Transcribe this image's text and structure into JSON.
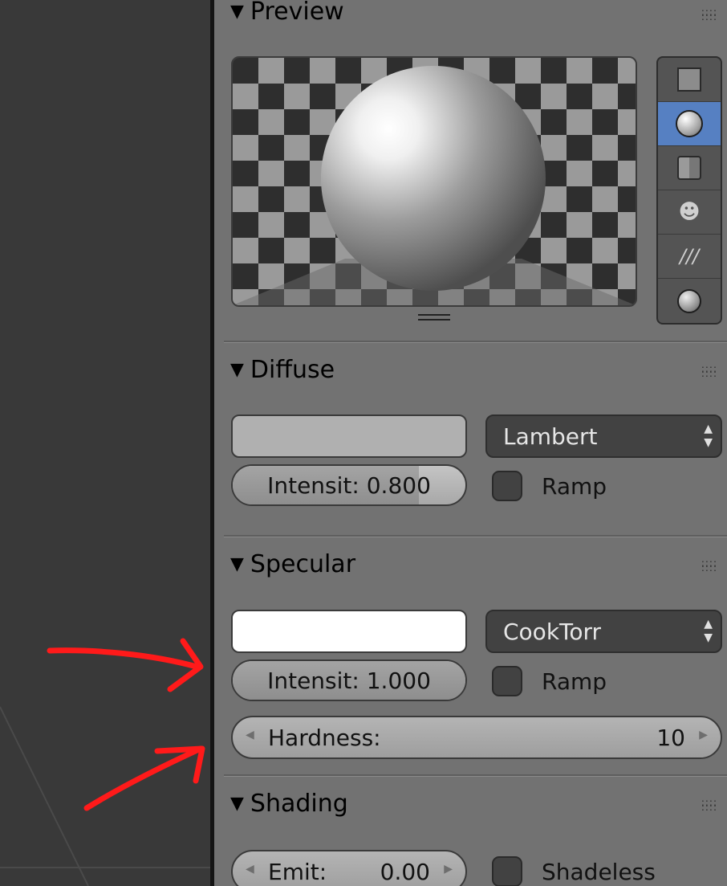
{
  "panels": {
    "preview": {
      "title": "Preview",
      "types": [
        "flat-plane-icon",
        "sphere-icon",
        "cube-icon",
        "monkey-icon",
        "hair-icon",
        "sphere-a-icon"
      ],
      "active_type": 1
    },
    "diffuse": {
      "title": "Diffuse",
      "color": "#b0b0b0",
      "shader": "Lambert",
      "intensity_label": "Intensit:",
      "intensity_value": "0.800",
      "intensity_fraction": 0.8,
      "ramp_label": "Ramp"
    },
    "specular": {
      "title": "Specular",
      "color": "#ffffff",
      "shader": "CookTorr",
      "intensity_label": "Intensit:",
      "intensity_value": "1.000",
      "intensity_fraction": 1.0,
      "ramp_label": "Ramp",
      "hardness_label": "Hardness:",
      "hardness_value": "10"
    },
    "shading": {
      "title": "Shading",
      "emit_label": "Emit:",
      "emit_value": "0.00",
      "shadeless_label": "Shadeless"
    }
  },
  "annotation": {
    "arrow_color": "#ff1a1a"
  },
  "colors": {
    "accent": "#5680c2",
    "panel_bg": "#727272",
    "viewport_bg": "#393939"
  }
}
